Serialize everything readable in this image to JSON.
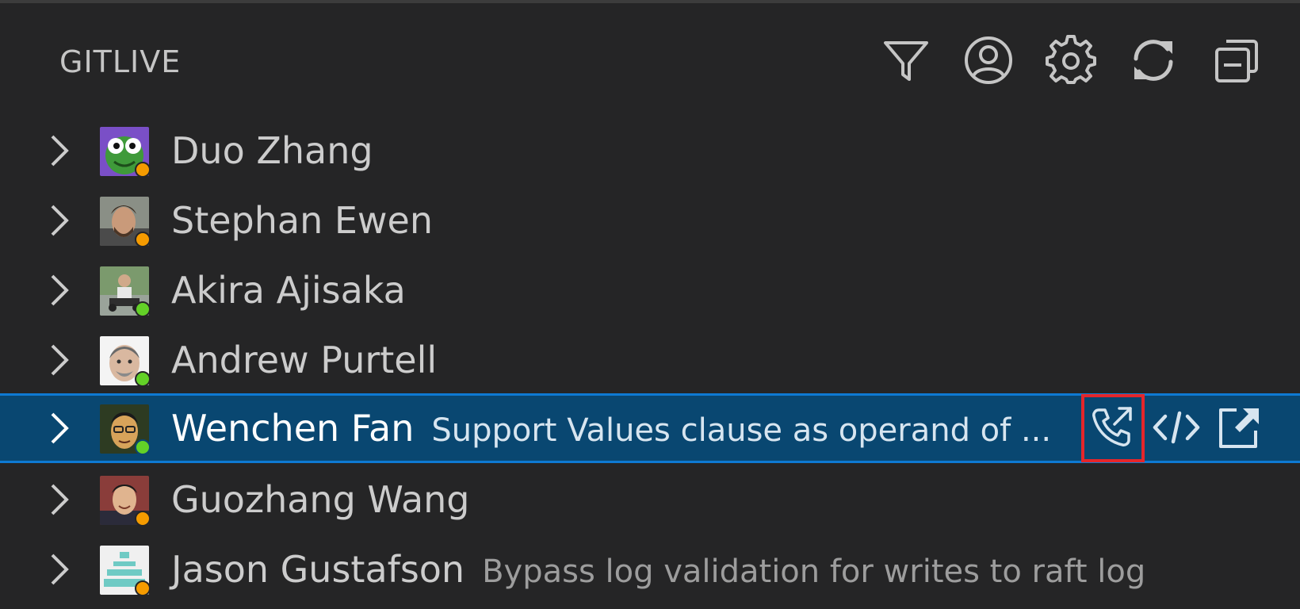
{
  "panel": {
    "title": "GITLIVE",
    "actions": [
      {
        "name": "filter-icon",
        "label": "Filter"
      },
      {
        "name": "account-icon",
        "label": "Account"
      },
      {
        "name": "gear-icon",
        "label": "Settings"
      },
      {
        "name": "refresh-icon",
        "label": "Refresh"
      },
      {
        "name": "collapse-all-icon",
        "label": "Collapse All"
      }
    ]
  },
  "colors": {
    "background": "#252526",
    "selected_row": "#094771",
    "selected_border": "#0e7ad3",
    "status_away": "#f59b00",
    "status_online": "#63d127",
    "highlight": "#e5262b"
  },
  "users": [
    {
      "name": "Duo Zhang",
      "description": "",
      "status": "away",
      "avatar": "cartoon-frog"
    },
    {
      "name": "Stephan Ewen",
      "description": "",
      "status": "away",
      "avatar": "photo"
    },
    {
      "name": "Akira Ajisaka",
      "description": "",
      "status": "online",
      "avatar": "photo"
    },
    {
      "name": "Andrew Purtell",
      "description": "",
      "status": "online",
      "avatar": "memoji"
    },
    {
      "name": "Wenchen Fan",
      "description": "Support Values clause as operand of ...",
      "status": "online",
      "avatar": "photo",
      "selected": true
    },
    {
      "name": "Guozhang Wang",
      "description": "",
      "status": "away",
      "avatar": "photo"
    },
    {
      "name": "Jason Gustafson",
      "description": "Bypass log validation for writes to raft log",
      "status": "away",
      "avatar": "identicon"
    }
  ],
  "row_actions": [
    {
      "name": "call-icon",
      "label": "Call"
    },
    {
      "name": "code-icon",
      "label": "Open Code"
    },
    {
      "name": "external-link-icon",
      "label": "Open in New Window"
    }
  ]
}
